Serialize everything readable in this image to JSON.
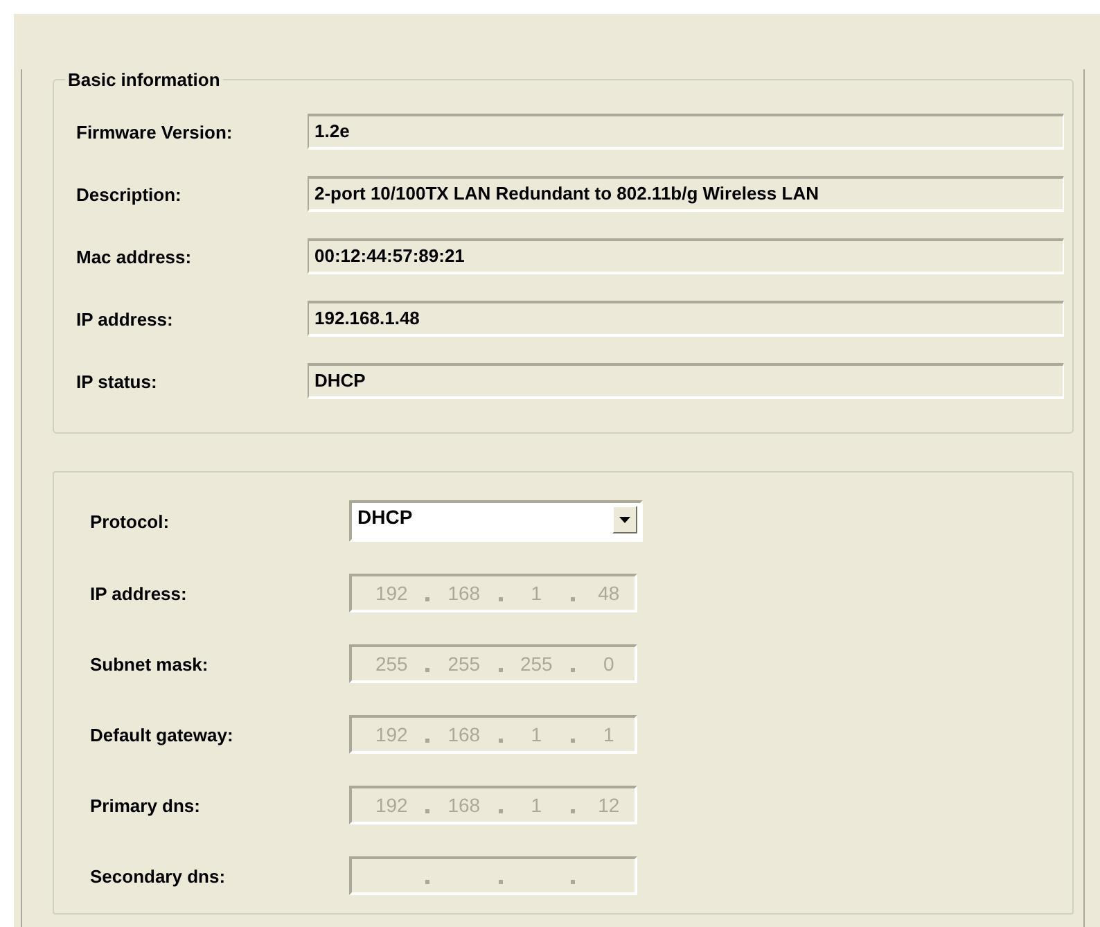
{
  "basic_information": {
    "title": "Basic information",
    "fields": [
      {
        "label": "Firmware Version:",
        "value": "1.2e"
      },
      {
        "label": "Description:",
        "value": "2-port 10/100TX LAN Redundant to 802.11b/g Wireless LAN"
      },
      {
        "label": "Mac address:",
        "value": "00:12:44:57:89:21"
      },
      {
        "label": "IP address:",
        "value": "192.168.1.48"
      },
      {
        "label": "IP status:",
        "value": "DHCP"
      }
    ]
  },
  "network_settings": {
    "protocol": {
      "label": "Protocol:",
      "value": "DHCP"
    },
    "fields": [
      {
        "label": "IP address:",
        "disabled": true,
        "octets": [
          "192",
          "168",
          "1",
          "48"
        ]
      },
      {
        "label": "Subnet mask:",
        "disabled": true,
        "octets": [
          "255",
          "255",
          "255",
          "0"
        ]
      },
      {
        "label": "Default gateway:",
        "disabled": true,
        "octets": [
          "192",
          "168",
          "1",
          "1"
        ]
      },
      {
        "label": "Primary dns:",
        "disabled": true,
        "octets": [
          "192",
          "168",
          "1",
          "12"
        ]
      },
      {
        "label": "Secondary dns:",
        "disabled": true
      }
    ]
  }
}
